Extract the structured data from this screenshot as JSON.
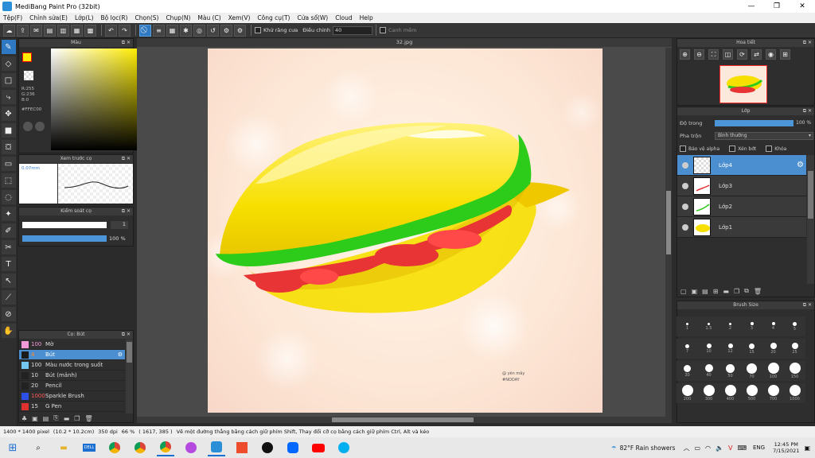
{
  "window": {
    "title": "MediBang Paint Pro (32bit)",
    "controls": [
      "—",
      "❐",
      "✕"
    ]
  },
  "menu": [
    "Tệp(F)",
    "Chỉnh sửa(E)",
    "Lớp(L)",
    "Bộ lọc(R)",
    "Chọn(S)",
    "Chụp(N)",
    "Màu (C)",
    "Xem(V)",
    "Công cụ(T)",
    "Cửa sổ(W)",
    "Cloud",
    "Help"
  ],
  "toolbar": {
    "antialias_label": "Khử răng cưa",
    "adjust_label": "Điều chỉnh",
    "adjust_value": "40",
    "align_label": "Canh mềm"
  },
  "color_panel": {
    "title": "Màu",
    "r": "R:255",
    "g": "G:236",
    "b": "B:0",
    "hex": "#FFEC00",
    "current_color": "#FFEC00"
  },
  "brush_preview": {
    "title": "Xem trước cọ",
    "size": "0.07mm"
  },
  "brush_control": {
    "title": "Kiểm soát cọ",
    "size_value": "1",
    "opacity_value": "100 %"
  },
  "brush_list": {
    "title": "Cọ: Bút",
    "items": [
      {
        "size": "100",
        "name": "Mờ",
        "color": "#f29ad8"
      },
      {
        "size": "4",
        "name": "Bút",
        "color": "#1b1b1b"
      },
      {
        "size": "100",
        "name": "Màu nước trong suốt",
        "color": "#74c7ef"
      },
      {
        "size": "10",
        "name": "Bút (mảnh)",
        "color": "#222222"
      },
      {
        "size": "20",
        "name": "Pencil",
        "color": "#222222"
      },
      {
        "size": "1000",
        "name": "Sparkle Brush",
        "color": "#2d50e6"
      },
      {
        "size": "15",
        "name": "G Pen",
        "color": "#e03030"
      }
    ]
  },
  "canvas": {
    "tab_title": "32.jpg",
    "signature": "@ yên mây\n#NODAY"
  },
  "navigator": {
    "title": "Hoa tiết"
  },
  "layer_panel": {
    "title": "Lớp",
    "opacity_label": "Độ trong",
    "opacity_value": "100 %",
    "opacity_fraction": 1.0,
    "blend_label": "Pha trộn",
    "blend_value": "Bình thường",
    "protect_alpha": "Bảo vệ alpha",
    "clipping": "Xén bớt",
    "lock": "Khóa",
    "layers": [
      "Lớp4",
      "Lớp3",
      "Lớp2",
      "Lớp1"
    ]
  },
  "brush_size": {
    "title": "Brush Size",
    "sizes": [
      "1",
      "1.5",
      "2",
      "3",
      "4",
      "5",
      "7",
      "10",
      "12",
      "15",
      "20",
      "25",
      "30",
      "40",
      "50",
      "70",
      "100",
      "150",
      "200",
      "300",
      "400",
      "500",
      "700",
      "1000"
    ]
  },
  "status": {
    "dimensions": "1400 * 1400 pixel",
    "physical": "(10.2 * 10.2cm)",
    "dpi": "350 dpi",
    "zoom": "66 %",
    "coords": "( 1617, 385 )",
    "hint": "Vẽ một đường thẳng bằng cách giữ phím Shift, Thay đổi cỡ cọ bằng cách giữ phím Ctrl, Alt và kéo"
  },
  "taskbar": {
    "weather": "82°F  Rain showers",
    "lang": "ENG",
    "time": "12:45 PM",
    "date": "7/15/2021"
  }
}
